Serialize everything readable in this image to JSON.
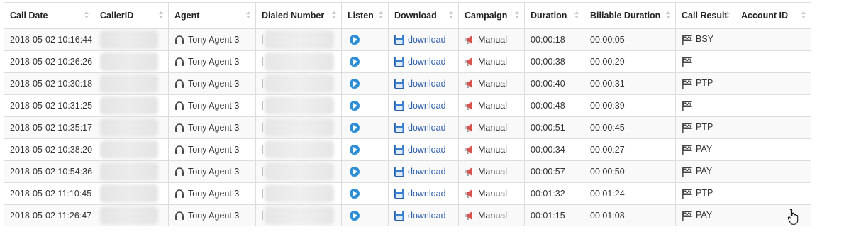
{
  "columns": [
    "Call Date",
    "CallerID",
    "Agent",
    "Dialed Number",
    "Listen",
    "Download",
    "Campaign",
    "Duration",
    "Billable Duration",
    "Call Result",
    "Account ID"
  ],
  "rows": [
    {
      "date": "2018-05-02 10:16:44",
      "agent": "Tony Agent 3",
      "download": "download",
      "campaign": "Manual",
      "duration": "00:00:18",
      "billable": "00:00:05",
      "result": "BSY"
    },
    {
      "date": "2018-05-02 10:26:26",
      "agent": "Tony Agent 3",
      "download": "download",
      "campaign": "Manual",
      "duration": "00:00:38",
      "billable": "00:00:29",
      "result": ""
    },
    {
      "date": "2018-05-02 10:30:18",
      "agent": "Tony Agent 3",
      "download": "download",
      "campaign": "Manual",
      "duration": "00:00:40",
      "billable": "00:00:31",
      "result": "PTP"
    },
    {
      "date": "2018-05-02 10:31:25",
      "agent": "Tony Agent 3",
      "download": "download",
      "campaign": "Manual",
      "duration": "00:00:48",
      "billable": "00:00:39",
      "result": ""
    },
    {
      "date": "2018-05-02 10:35:17",
      "agent": "Tony Agent 3",
      "download": "download",
      "campaign": "Manual",
      "duration": "00:00:51",
      "billable": "00:00:45",
      "result": "PTP"
    },
    {
      "date": "2018-05-02 10:38:20",
      "agent": "Tony Agent 3",
      "download": "download",
      "campaign": "Manual",
      "duration": "00:00:34",
      "billable": "00:00:27",
      "result": "PAY"
    },
    {
      "date": "2018-05-02 10:54:36",
      "agent": "Tony Agent 3",
      "download": "download",
      "campaign": "Manual",
      "duration": "00:00:57",
      "billable": "00:00:50",
      "result": "PAY"
    },
    {
      "date": "2018-05-02 11:10:45",
      "agent": "Tony Agent 3",
      "download": "download",
      "campaign": "Manual",
      "duration": "00:01:32",
      "billable": "00:01:24",
      "result": "PTP"
    },
    {
      "date": "2018-05-02 11:26:47",
      "agent": "Tony Agent 3",
      "download": "download",
      "campaign": "Manual",
      "duration": "00:01:15",
      "billable": "00:01:08",
      "result": "PAY"
    }
  ],
  "colors": {
    "link": "#2a5ca8",
    "play": "#2e8ed6",
    "border": "#dddddd",
    "stripe": "#f9f9f9"
  },
  "icons": {
    "agent": "headset-icon",
    "listen": "play-icon",
    "download": "floppy-disk-icon",
    "campaign": "megaphone-icon",
    "result": "flag-icon",
    "cursor": "hand-pointer-icon"
  }
}
